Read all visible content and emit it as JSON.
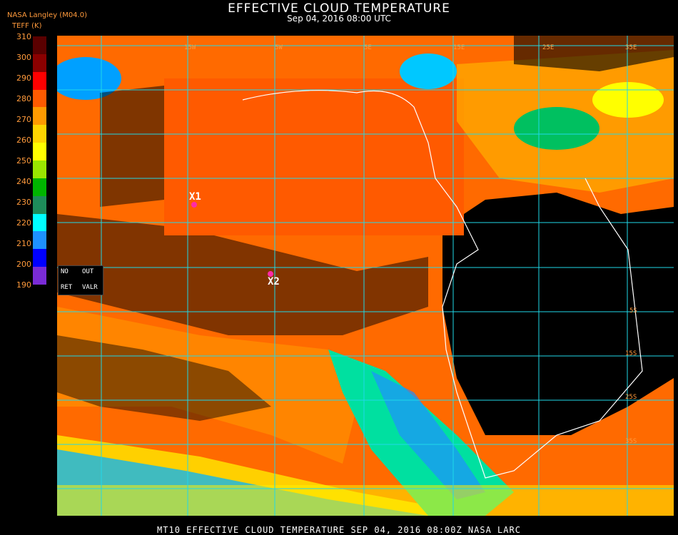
{
  "header": {
    "title": "EFFECTIVE CLOUD TEMPERATURE",
    "subtitle": "Sep 04, 2016 08:00 UTC",
    "source": "NASA Langley (M04.0)",
    "variable": "TEFF (K)"
  },
  "scale": {
    "ticks": [
      "310",
      "300",
      "290",
      "280",
      "270",
      "260",
      "250",
      "240",
      "230",
      "220",
      "210",
      "200",
      "190"
    ],
    "colors": [
      "#5a0000",
      "#8b0000",
      "#ff0000",
      "#ff5a00",
      "#ff9a00",
      "#ffd500",
      "#ffff00",
      "#9ae600",
      "#00b400",
      "#1e8c5a",
      "#00ffff",
      "#1e90ff",
      "#0000ff",
      "#7a2bd6"
    ]
  },
  "legend_box": {
    "no": "NO",
    "out": "OUT",
    "ret": "RET",
    "valr": "VALR"
  },
  "map": {
    "markers": [
      {
        "label": "X1"
      },
      {
        "label": "X2"
      }
    ],
    "grid_labels": [
      "15W",
      "5W",
      "5E",
      "15E",
      "25E",
      "35E",
      "5S",
      "15S",
      "25S",
      "35S"
    ]
  },
  "footer": {
    "caption": "MT10  EFFECTIVE CLOUD TEMPERATURE   SEP 04, 2016 08:00Z   NASA LARC"
  }
}
